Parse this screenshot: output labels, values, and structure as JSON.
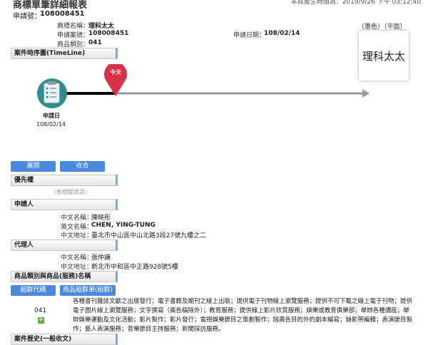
{
  "header": {
    "title": "商標單筆詳細報表",
    "generated": "本頁產生時間為：2019/9/26 下午 03:12:40",
    "app_no_label": "申請號：",
    "app_no": "108008451"
  },
  "summary": {
    "name_label": "商標名稱：",
    "name": "理科太太",
    "case_label": "申請案號：",
    "case": "108008451",
    "class_label": "商品類別：",
    "class": "041",
    "date_label": "申請日期：",
    "date": "108/02/14"
  },
  "mark": {
    "tags": "（墨色）（平面）",
    "text": "理科太太"
  },
  "timeline": {
    "section": "案件時序圖(TimeLine)",
    "today": "今天",
    "event_label": "申請日",
    "event_date": "108/02/14"
  },
  "controls": {
    "expand": "展開",
    "collapse": "收合"
  },
  "priority": {
    "section": "優先權",
    "empty": "（無相關資訊）"
  },
  "applicant": {
    "section": "申請人",
    "cname_label": "中文名稱：",
    "cname": "陳映彤",
    "ename_label": "英文名稱：",
    "ename": "CHEN, YING-TUNG",
    "addr_label": "中文地址：",
    "addr": "臺北市中山區中山北路3段27號九樓之二"
  },
  "agent": {
    "section": "代理人",
    "cname_label": "中文名稱：",
    "cname": "張仲謙",
    "addr_label": "中文地址：",
    "addr": "新北市中和區中正路928號5樓"
  },
  "goods": {
    "section": "商品類別與商品(服務)名稱",
    "group_code_btn": "組群代碼",
    "group_btn": "商品組群單(組群)",
    "class_code": "041",
    "desc": "各種書刊雜誌文獻之出版發行；電子書籍及期刊之線上出版；提供電子刊物線上瀏覽服務；提供不可下載之線上電子刊物；提供電子圖片線上瀏覽服務；文字撰寫（廣告稿除外）；教育服務；提供線上影片欣賞服務；娛樂或教育俱樂部；舉辦各種講座；舉辦娛樂運動及文化活動；影片製作；影片發行；電視娛樂節目之策劃製作；除廣告目的外的劇本編寫；錄影帶編輯；表演節目製作；藝人表演服務；音樂節目主持服務；新聞採訪服務。"
  },
  "history": {
    "section": "案件歷史(一般收文)"
  },
  "colors": {
    "accent": "#4a89dc",
    "timeline_red": "#d9304a",
    "plus_green": "#5cae3f"
  }
}
